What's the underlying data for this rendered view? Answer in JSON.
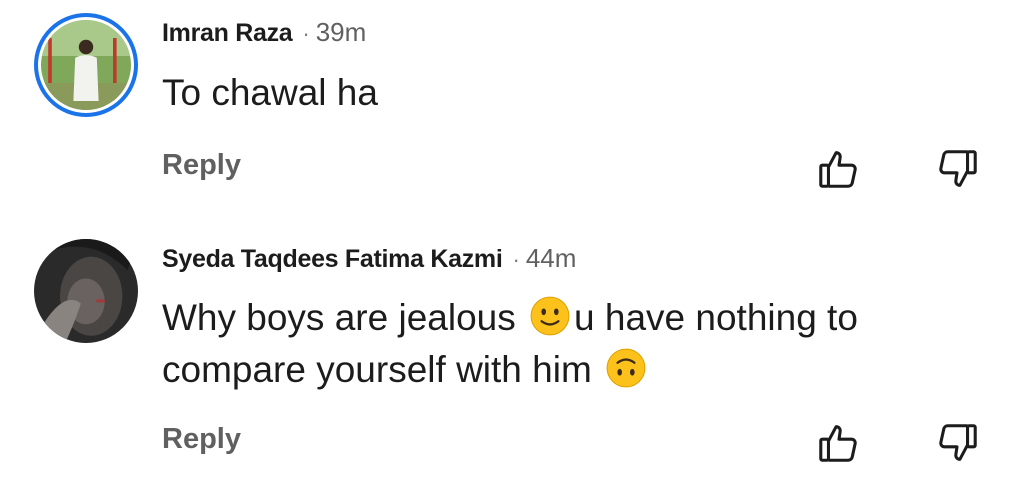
{
  "comments": [
    {
      "author": "Imran Raza",
      "separator": "·",
      "time": "39m",
      "text": "To chawal ha",
      "reply_label": "Reply",
      "avatar_ring_color": "#1a73e8"
    },
    {
      "author": "Syeda Taqdees Fatima Kazmi",
      "separator": "·",
      "time": "44m",
      "text_part1": "Why boys are jealous ",
      "emoji1": "slightly-smiling-face",
      "text_part2": "u have nothing to compare yourself with him ",
      "emoji2": "upside-down-face",
      "reply_label": "Reply"
    }
  ],
  "icons": {
    "like": "thumbs-up-outline-icon",
    "dislike": "thumbs-down-outline-icon"
  },
  "colors": {
    "text": "#1c1c1c",
    "secondary": "#606060",
    "background": "#ffffff"
  }
}
